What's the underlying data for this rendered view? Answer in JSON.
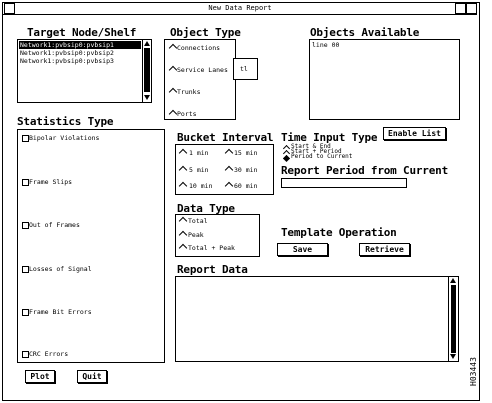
{
  "window": {
    "title": "New Data Report"
  },
  "target": {
    "heading": "Target Node/Shelf",
    "items": [
      "Network1:pvbsip0:pvbsip1",
      "Network1:pvbsip0:pvbsip2",
      "Network1:pvbsip0:pvbsip3"
    ],
    "selected_index": 0
  },
  "object_type": {
    "heading": "Object Type",
    "items": [
      "Connections",
      "Service Lanes",
      "Trunks",
      "Ports"
    ],
    "popup_fragment": "tl"
  },
  "objects_available": {
    "heading": "Objects Available",
    "items": [
      "line 00"
    ]
  },
  "statistics": {
    "heading": "Statistics Type",
    "items": [
      "Bipolar Violations",
      "Frame Slips",
      "Out of Frames",
      "Losses of Signal",
      "Frame Bit Errors",
      "CRC Errors"
    ]
  },
  "bucket": {
    "heading": "Bucket Interval",
    "options": [
      "1 min",
      "15 min",
      "5 min",
      "30 min",
      "10 min",
      "60 min"
    ]
  },
  "time_input": {
    "heading": "Time Input Type",
    "enable_list_label": "Enable List",
    "options": [
      "Start & End",
      "Start + Period",
      "Period to Current"
    ],
    "selected_index": 2
  },
  "report_period": {
    "label": "Report Period from Current",
    "value": ""
  },
  "data_type": {
    "heading": "Data Type",
    "options": [
      "Total",
      "Peak",
      "Total + Peak"
    ]
  },
  "template": {
    "heading": "Template Operation",
    "save_label": "Save",
    "retrieve_label": "Retrieve"
  },
  "report_data": {
    "heading": "Report Data",
    "value": ""
  },
  "footer": {
    "plot_label": "Plot",
    "quit_label": "Quit"
  },
  "side_code": "H03443"
}
